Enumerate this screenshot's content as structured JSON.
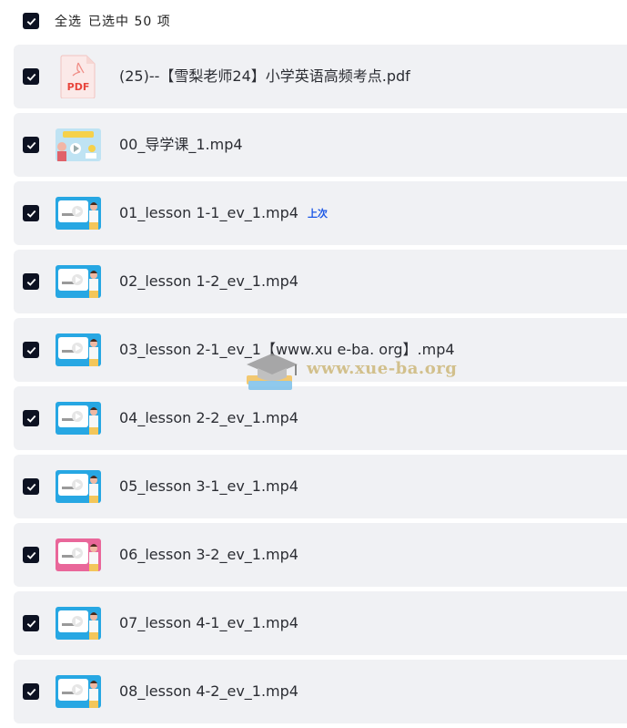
{
  "header": {
    "select_all_label": "全选",
    "selected_text": "已选中  50  项"
  },
  "files": [
    {
      "name": "(25)--【雪梨老师24】小学英语高频考点.pdf",
      "type": "pdf",
      "thumb_text": "PDF",
      "tag": ""
    },
    {
      "name": "00_导学课_1.mp4",
      "type": "video",
      "thumb_theme": "intro",
      "tag": ""
    },
    {
      "name": "01_lesson 1-1_ev_1.mp4",
      "type": "video",
      "thumb_theme": "blue",
      "tag": "上次"
    },
    {
      "name": "02_lesson 1-2_ev_1.mp4",
      "type": "video",
      "thumb_theme": "blue",
      "tag": ""
    },
    {
      "name": "03_lesson 2-1_ev_1【www.xu e-ba. org】.mp4",
      "type": "video",
      "thumb_theme": "blue",
      "tag": ""
    },
    {
      "name": "04_lesson 2-2_ev_1.mp4",
      "type": "video",
      "thumb_theme": "blue",
      "tag": ""
    },
    {
      "name": "05_lesson 3-1_ev_1.mp4",
      "type": "video",
      "thumb_theme": "blue",
      "tag": ""
    },
    {
      "name": "06_lesson 3-2_ev_1.mp4",
      "type": "video",
      "thumb_theme": "pink",
      "tag": ""
    },
    {
      "name": "07_lesson 4-1_ev_1.mp4",
      "type": "video",
      "thumb_theme": "blue",
      "tag": ""
    },
    {
      "name": "08_lesson 4-2_ev_1.mp4",
      "type": "video",
      "thumb_theme": "blue",
      "tag": ""
    }
  ],
  "watermark": {
    "text": "www.xue-ba.org"
  },
  "colors": {
    "checkbox": "#0d1222",
    "row_bg": "#f0f1f4",
    "tag": "#1a56e6",
    "pdf_red": "#e8453c"
  }
}
